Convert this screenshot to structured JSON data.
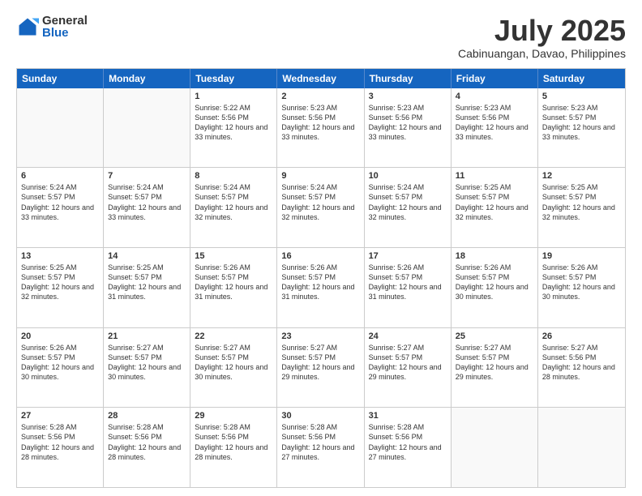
{
  "logo": {
    "general": "General",
    "blue": "Blue"
  },
  "title": "July 2025",
  "location": "Cabinuangan, Davao, Philippines",
  "weekdays": [
    "Sunday",
    "Monday",
    "Tuesday",
    "Wednesday",
    "Thursday",
    "Friday",
    "Saturday"
  ],
  "weeks": [
    [
      {
        "day": "",
        "empty": true
      },
      {
        "day": "",
        "empty": true
      },
      {
        "day": "1",
        "sunrise": "Sunrise: 5:22 AM",
        "sunset": "Sunset: 5:56 PM",
        "daylight": "Daylight: 12 hours and 33 minutes."
      },
      {
        "day": "2",
        "sunrise": "Sunrise: 5:23 AM",
        "sunset": "Sunset: 5:56 PM",
        "daylight": "Daylight: 12 hours and 33 minutes."
      },
      {
        "day": "3",
        "sunrise": "Sunrise: 5:23 AM",
        "sunset": "Sunset: 5:56 PM",
        "daylight": "Daylight: 12 hours and 33 minutes."
      },
      {
        "day": "4",
        "sunrise": "Sunrise: 5:23 AM",
        "sunset": "Sunset: 5:56 PM",
        "daylight": "Daylight: 12 hours and 33 minutes."
      },
      {
        "day": "5",
        "sunrise": "Sunrise: 5:23 AM",
        "sunset": "Sunset: 5:57 PM",
        "daylight": "Daylight: 12 hours and 33 minutes."
      }
    ],
    [
      {
        "day": "6",
        "sunrise": "Sunrise: 5:24 AM",
        "sunset": "Sunset: 5:57 PM",
        "daylight": "Daylight: 12 hours and 33 minutes."
      },
      {
        "day": "7",
        "sunrise": "Sunrise: 5:24 AM",
        "sunset": "Sunset: 5:57 PM",
        "daylight": "Daylight: 12 hours and 33 minutes."
      },
      {
        "day": "8",
        "sunrise": "Sunrise: 5:24 AM",
        "sunset": "Sunset: 5:57 PM",
        "daylight": "Daylight: 12 hours and 32 minutes."
      },
      {
        "day": "9",
        "sunrise": "Sunrise: 5:24 AM",
        "sunset": "Sunset: 5:57 PM",
        "daylight": "Daylight: 12 hours and 32 minutes."
      },
      {
        "day": "10",
        "sunrise": "Sunrise: 5:24 AM",
        "sunset": "Sunset: 5:57 PM",
        "daylight": "Daylight: 12 hours and 32 minutes."
      },
      {
        "day": "11",
        "sunrise": "Sunrise: 5:25 AM",
        "sunset": "Sunset: 5:57 PM",
        "daylight": "Daylight: 12 hours and 32 minutes."
      },
      {
        "day": "12",
        "sunrise": "Sunrise: 5:25 AM",
        "sunset": "Sunset: 5:57 PM",
        "daylight": "Daylight: 12 hours and 32 minutes."
      }
    ],
    [
      {
        "day": "13",
        "sunrise": "Sunrise: 5:25 AM",
        "sunset": "Sunset: 5:57 PM",
        "daylight": "Daylight: 12 hours and 32 minutes."
      },
      {
        "day": "14",
        "sunrise": "Sunrise: 5:25 AM",
        "sunset": "Sunset: 5:57 PM",
        "daylight": "Daylight: 12 hours and 31 minutes."
      },
      {
        "day": "15",
        "sunrise": "Sunrise: 5:26 AM",
        "sunset": "Sunset: 5:57 PM",
        "daylight": "Daylight: 12 hours and 31 minutes."
      },
      {
        "day": "16",
        "sunrise": "Sunrise: 5:26 AM",
        "sunset": "Sunset: 5:57 PM",
        "daylight": "Daylight: 12 hours and 31 minutes."
      },
      {
        "day": "17",
        "sunrise": "Sunrise: 5:26 AM",
        "sunset": "Sunset: 5:57 PM",
        "daylight": "Daylight: 12 hours and 31 minutes."
      },
      {
        "day": "18",
        "sunrise": "Sunrise: 5:26 AM",
        "sunset": "Sunset: 5:57 PM",
        "daylight": "Daylight: 12 hours and 30 minutes."
      },
      {
        "day": "19",
        "sunrise": "Sunrise: 5:26 AM",
        "sunset": "Sunset: 5:57 PM",
        "daylight": "Daylight: 12 hours and 30 minutes."
      }
    ],
    [
      {
        "day": "20",
        "sunrise": "Sunrise: 5:26 AM",
        "sunset": "Sunset: 5:57 PM",
        "daylight": "Daylight: 12 hours and 30 minutes."
      },
      {
        "day": "21",
        "sunrise": "Sunrise: 5:27 AM",
        "sunset": "Sunset: 5:57 PM",
        "daylight": "Daylight: 12 hours and 30 minutes."
      },
      {
        "day": "22",
        "sunrise": "Sunrise: 5:27 AM",
        "sunset": "Sunset: 5:57 PM",
        "daylight": "Daylight: 12 hours and 30 minutes."
      },
      {
        "day": "23",
        "sunrise": "Sunrise: 5:27 AM",
        "sunset": "Sunset: 5:57 PM",
        "daylight": "Daylight: 12 hours and 29 minutes."
      },
      {
        "day": "24",
        "sunrise": "Sunrise: 5:27 AM",
        "sunset": "Sunset: 5:57 PM",
        "daylight": "Daylight: 12 hours and 29 minutes."
      },
      {
        "day": "25",
        "sunrise": "Sunrise: 5:27 AM",
        "sunset": "Sunset: 5:57 PM",
        "daylight": "Daylight: 12 hours and 29 minutes."
      },
      {
        "day": "26",
        "sunrise": "Sunrise: 5:27 AM",
        "sunset": "Sunset: 5:56 PM",
        "daylight": "Daylight: 12 hours and 28 minutes."
      }
    ],
    [
      {
        "day": "27",
        "sunrise": "Sunrise: 5:28 AM",
        "sunset": "Sunset: 5:56 PM",
        "daylight": "Daylight: 12 hours and 28 minutes."
      },
      {
        "day": "28",
        "sunrise": "Sunrise: 5:28 AM",
        "sunset": "Sunset: 5:56 PM",
        "daylight": "Daylight: 12 hours and 28 minutes."
      },
      {
        "day": "29",
        "sunrise": "Sunrise: 5:28 AM",
        "sunset": "Sunset: 5:56 PM",
        "daylight": "Daylight: 12 hours and 28 minutes."
      },
      {
        "day": "30",
        "sunrise": "Sunrise: 5:28 AM",
        "sunset": "Sunset: 5:56 PM",
        "daylight": "Daylight: 12 hours and 27 minutes."
      },
      {
        "day": "31",
        "sunrise": "Sunrise: 5:28 AM",
        "sunset": "Sunset: 5:56 PM",
        "daylight": "Daylight: 12 hours and 27 minutes."
      },
      {
        "day": "",
        "empty": true
      },
      {
        "day": "",
        "empty": true
      }
    ]
  ]
}
